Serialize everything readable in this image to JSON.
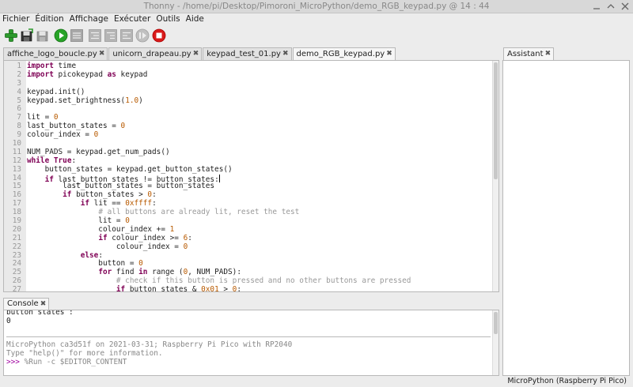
{
  "window": {
    "title": "Thonny  -  /home/pi/Desktop/Pimoroni_MicroPython/demo_RGB_keypad.py  @  14 : 44"
  },
  "menu": [
    "Fichier",
    "Édition",
    "Affichage",
    "Exécuter",
    "Outils",
    "Aide"
  ],
  "toolbar": {
    "buttons": [
      "new-file",
      "open-file",
      "save-file",
      "run",
      "debug",
      "step-over",
      "step-into",
      "step-out",
      "resume",
      "stop"
    ]
  },
  "editor": {
    "tabs": [
      {
        "label": "affiche_logo_boucle.py",
        "active": false
      },
      {
        "label": "unicorn_drapeau.py",
        "active": false
      },
      {
        "label": "keypad_test_01.py",
        "active": false
      },
      {
        "label": "demo_RGB_keypad.py",
        "active": true
      }
    ],
    "lines": [
      "import time",
      "import picokeypad as keypad",
      "",
      "keypad.init()",
      "keypad.set_brightness(1.0)",
      "",
      "lit = 0",
      "last_button_states = 0",
      "colour_index = 0",
      "",
      "NUM_PADS = keypad.get_num_pads()",
      "while True:",
      "    button_states = keypad.get_button_states()",
      "    if last_button_states != button_states:",
      "        last_button_states = button_states",
      "        if button_states > 0:",
      "            if lit == 0xffff:",
      "                # all buttons are already lit, reset the test",
      "                lit = 0",
      "                colour_index += 1",
      "                if colour_index >= 6:",
      "                    colour_index = 0",
      "            else:",
      "                button = 0",
      "                for find in range (0, NUM_PADS):",
      "                    # check if this button is pressed and no other buttons are pressed",
      "                    if button_states & 0x01 > 0:"
    ]
  },
  "console": {
    "tab_label": "Console",
    "previous_output": [
      "button states :",
      "0"
    ],
    "info": [
      "MicroPython ca3d51f on 2021-03-31; Raspberry Pi Pico with RP2040",
      "Type \"help()\" for more information."
    ],
    "prompt": ">>>",
    "command": " %Run -c $EDITOR_CONTENT"
  },
  "assistant": {
    "tab_label": "Assistant"
  },
  "status": {
    "interpreter": "MicroPython (Raspberry Pi Pico)"
  },
  "colors": {
    "keyword": "#7f0055",
    "number": "#b85a00",
    "comment": "#999999",
    "prompt": "#a000a0"
  }
}
